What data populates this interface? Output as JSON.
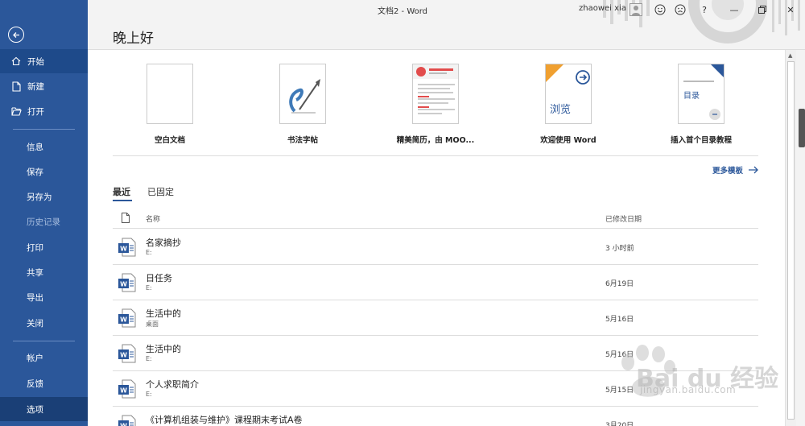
{
  "titlebar": {
    "doc_title": "文档2  -  Word",
    "user_name": "zhaowei xia",
    "help": "?",
    "minimize": "—",
    "close": "✕"
  },
  "sidebar": {
    "items": [
      {
        "label": "开始",
        "icon": "home-icon"
      },
      {
        "label": "新建",
        "icon": "new-doc-icon"
      },
      {
        "label": "打开",
        "icon": "folder-open-icon"
      },
      {
        "label": "信息"
      },
      {
        "label": "保存"
      },
      {
        "label": "另存为"
      },
      {
        "label": "历史记录"
      },
      {
        "label": "打印"
      },
      {
        "label": "共享"
      },
      {
        "label": "导出"
      },
      {
        "label": "关闭"
      },
      {
        "label": "帐户"
      },
      {
        "label": "反馈"
      },
      {
        "label": "选项"
      }
    ]
  },
  "main": {
    "greeting": "晚上好",
    "templates": [
      {
        "label": "空白文档"
      },
      {
        "label": "书法字帖"
      },
      {
        "label": "精美简历，由 MOO..."
      },
      {
        "label": "欢迎使用 Word",
        "thumb_text": "浏览"
      },
      {
        "label": "插入首个目录教程",
        "thumb_text": "目录"
      }
    ],
    "more_templates": "更多模板",
    "tabs": [
      "最近",
      "已固定"
    ],
    "table_headers": {
      "name": "名称",
      "modified": "已修改日期"
    },
    "recent": [
      {
        "name": "名家摘抄",
        "location": "E:",
        "date": "3 小时前"
      },
      {
        "name": "日任务",
        "location": "E:",
        "date": "6月19日"
      },
      {
        "name": "生活中的",
        "location": "桌面",
        "date": "5月16日"
      },
      {
        "name": "生活中的",
        "location": "E:",
        "date": "5月16日"
      },
      {
        "name": "个人求职简介",
        "location": "E:",
        "date": "5月15日"
      },
      {
        "name": "《计算机组装与维护》课程期末考试A卷",
        "location": "",
        "date": "3月20日"
      }
    ]
  },
  "watermark": {
    "text": "Bai du 经验",
    "sub": "jingyan.baidu.com"
  },
  "colors": {
    "accent": "#2b579a",
    "word_blue": "#2b579a"
  }
}
